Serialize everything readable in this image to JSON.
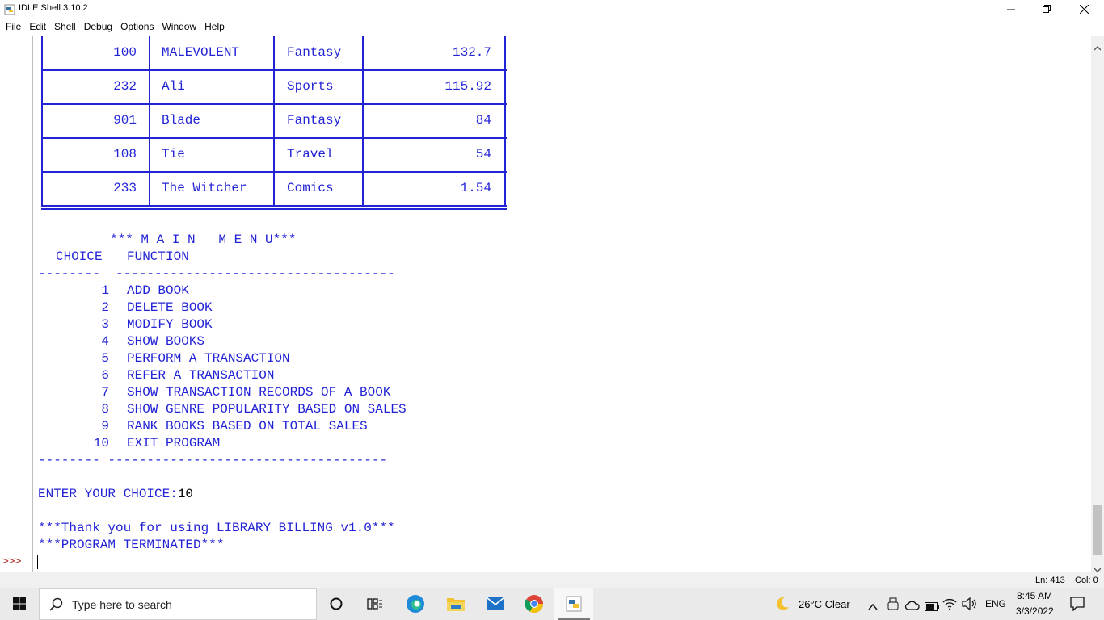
{
  "window": {
    "title": "IDLE Shell 3.10.2"
  },
  "menu": [
    "File",
    "Edit",
    "Shell",
    "Debug",
    "Options",
    "Window",
    "Help"
  ],
  "table": {
    "rows": [
      {
        "id": "100",
        "name": "MALEVOLENT",
        "genre": "Fantasy",
        "sales": "132.7"
      },
      {
        "id": "232",
        "name": "Ali",
        "genre": "Sports",
        "sales": "115.92"
      },
      {
        "id": "901",
        "name": "Blade",
        "genre": "Fantasy",
        "sales": "84"
      },
      {
        "id": "108",
        "name": "Tie",
        "genre": "Travel",
        "sales": "54"
      },
      {
        "id": "233",
        "name": "The Witcher",
        "genre": "Comics",
        "sales": "1.54"
      }
    ]
  },
  "main_menu": {
    "title": "*** M A I N   M E N U***",
    "header_choice": "CHOICE",
    "header_function": "FUNCTION",
    "divider_top": "--------  ------------------------------------",
    "divider_bottom": "-------- ------------------------------------",
    "items": [
      {
        "num": "1",
        "label": "ADD BOOK"
      },
      {
        "num": "2",
        "label": "DELETE BOOK"
      },
      {
        "num": "3",
        "label": "MODIFY BOOK"
      },
      {
        "num": "4",
        "label": "SHOW BOOKS"
      },
      {
        "num": "5",
        "label": "PERFORM A TRANSACTION"
      },
      {
        "num": "6",
        "label": "REFER A TRANSACTION"
      },
      {
        "num": "7",
        "label": "SHOW TRANSACTION RECORDS OF A BOOK"
      },
      {
        "num": "8",
        "label": "SHOW GENRE POPULARITY BASED ON SALES"
      },
      {
        "num": "9",
        "label": "RANK BOOKS BASED ON TOTAL SALES"
      },
      {
        "num": "10",
        "label": "EXIT PROGRAM"
      }
    ]
  },
  "output": {
    "choice_prompt": "ENTER YOUR CHOICE:",
    "choice_value": "10",
    "thanks": "***Thank you for using LIBRARY BILLING v1.0***",
    "terminated": "***PROGRAM TERMINATED***",
    "prompt": ">>>"
  },
  "status": {
    "line": "Ln: 413",
    "col": "Col: 0"
  },
  "taskbar": {
    "search_placeholder": "Type here to search",
    "weather": "26°C  Clear",
    "lang": "ENG",
    "time": "8:45 AM",
    "date": "3/3/2022"
  },
  "colors": {
    "shell_text": "#2323d6",
    "prompt": "#b33a3a"
  }
}
